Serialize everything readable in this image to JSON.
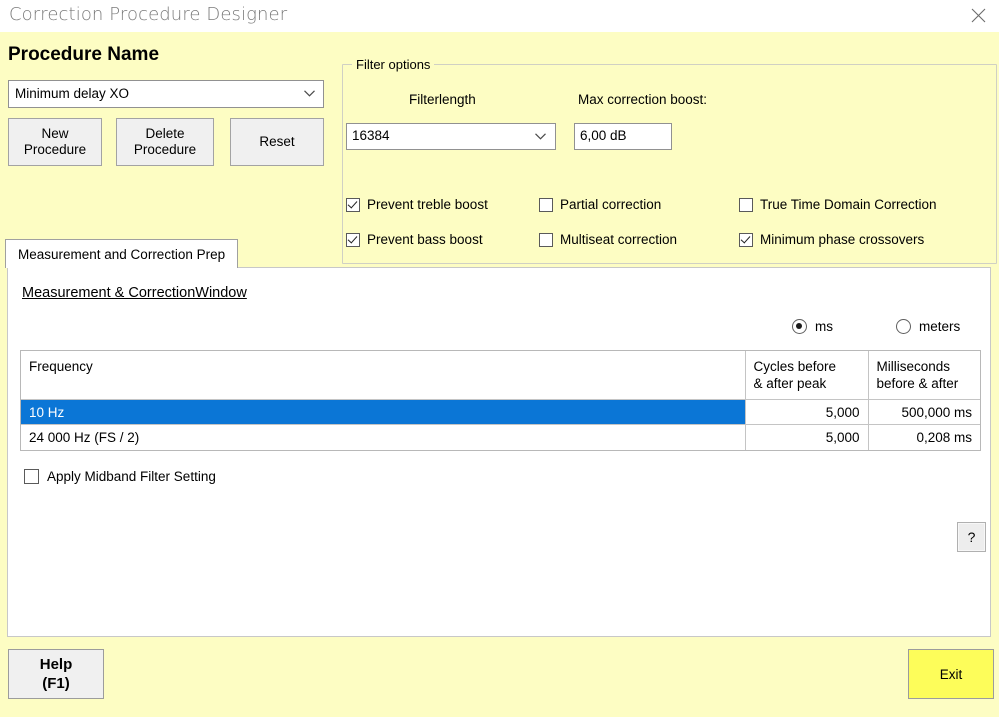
{
  "window": {
    "title": "Correction Procedure Designer",
    "close_icon": "close-icon"
  },
  "procedure": {
    "section_title": "Procedure Name",
    "selected": "Minimum delay XO",
    "dropdown_icon": "chevron-down-icon",
    "buttons": {
      "new": "New\nProcedure",
      "delete": "Delete\nProcedure",
      "reset": "Reset"
    }
  },
  "filter_options": {
    "legend": "Filter options",
    "filterlength_label": "Filterlength",
    "filterlength_value": "16384",
    "max_boost_label": "Max correction boost:",
    "max_boost_value": "6,00 dB",
    "checkboxes": [
      {
        "label": "Prevent treble boost",
        "checked": true
      },
      {
        "label": "Prevent bass boost",
        "checked": true
      },
      {
        "label": "Partial correction",
        "checked": false
      },
      {
        "label": "Multiseat correction",
        "checked": false
      },
      {
        "label": "True Time Domain Correction",
        "checked": false
      },
      {
        "label": "Minimum phase crossovers",
        "checked": true
      }
    ]
  },
  "tab": {
    "label": "Measurement and Correction Prep"
  },
  "panel": {
    "title": "Measurement & CorrectionWindow",
    "units": {
      "ms": {
        "label": "ms",
        "selected": true
      },
      "meters": {
        "label": "meters",
        "selected": false
      }
    },
    "table": {
      "headers": {
        "frequency": "Frequency",
        "cycles": "Cycles before\n& after peak",
        "milliseconds": "Milliseconds\nbefore & after"
      },
      "rows": [
        {
          "frequency": "10 Hz",
          "cycles": "5,000",
          "milliseconds": "500,000 ms",
          "selected": true
        },
        {
          "frequency": "24 000 Hz (FS / 2)",
          "cycles": "5,000",
          "milliseconds": "0,208 ms",
          "selected": false
        }
      ]
    },
    "apply_midband": {
      "label": "Apply Midband Filter Setting",
      "checked": false
    },
    "help_question_label": "?"
  },
  "footer": {
    "help_line1": "Help",
    "help_line2": "(F1)",
    "exit_label": "Exit"
  },
  "colors": {
    "background": "#fdfdc3",
    "selection": "#0b76d6",
    "exit_button": "#fdfd5a",
    "title_text": "#7a7a7a"
  }
}
